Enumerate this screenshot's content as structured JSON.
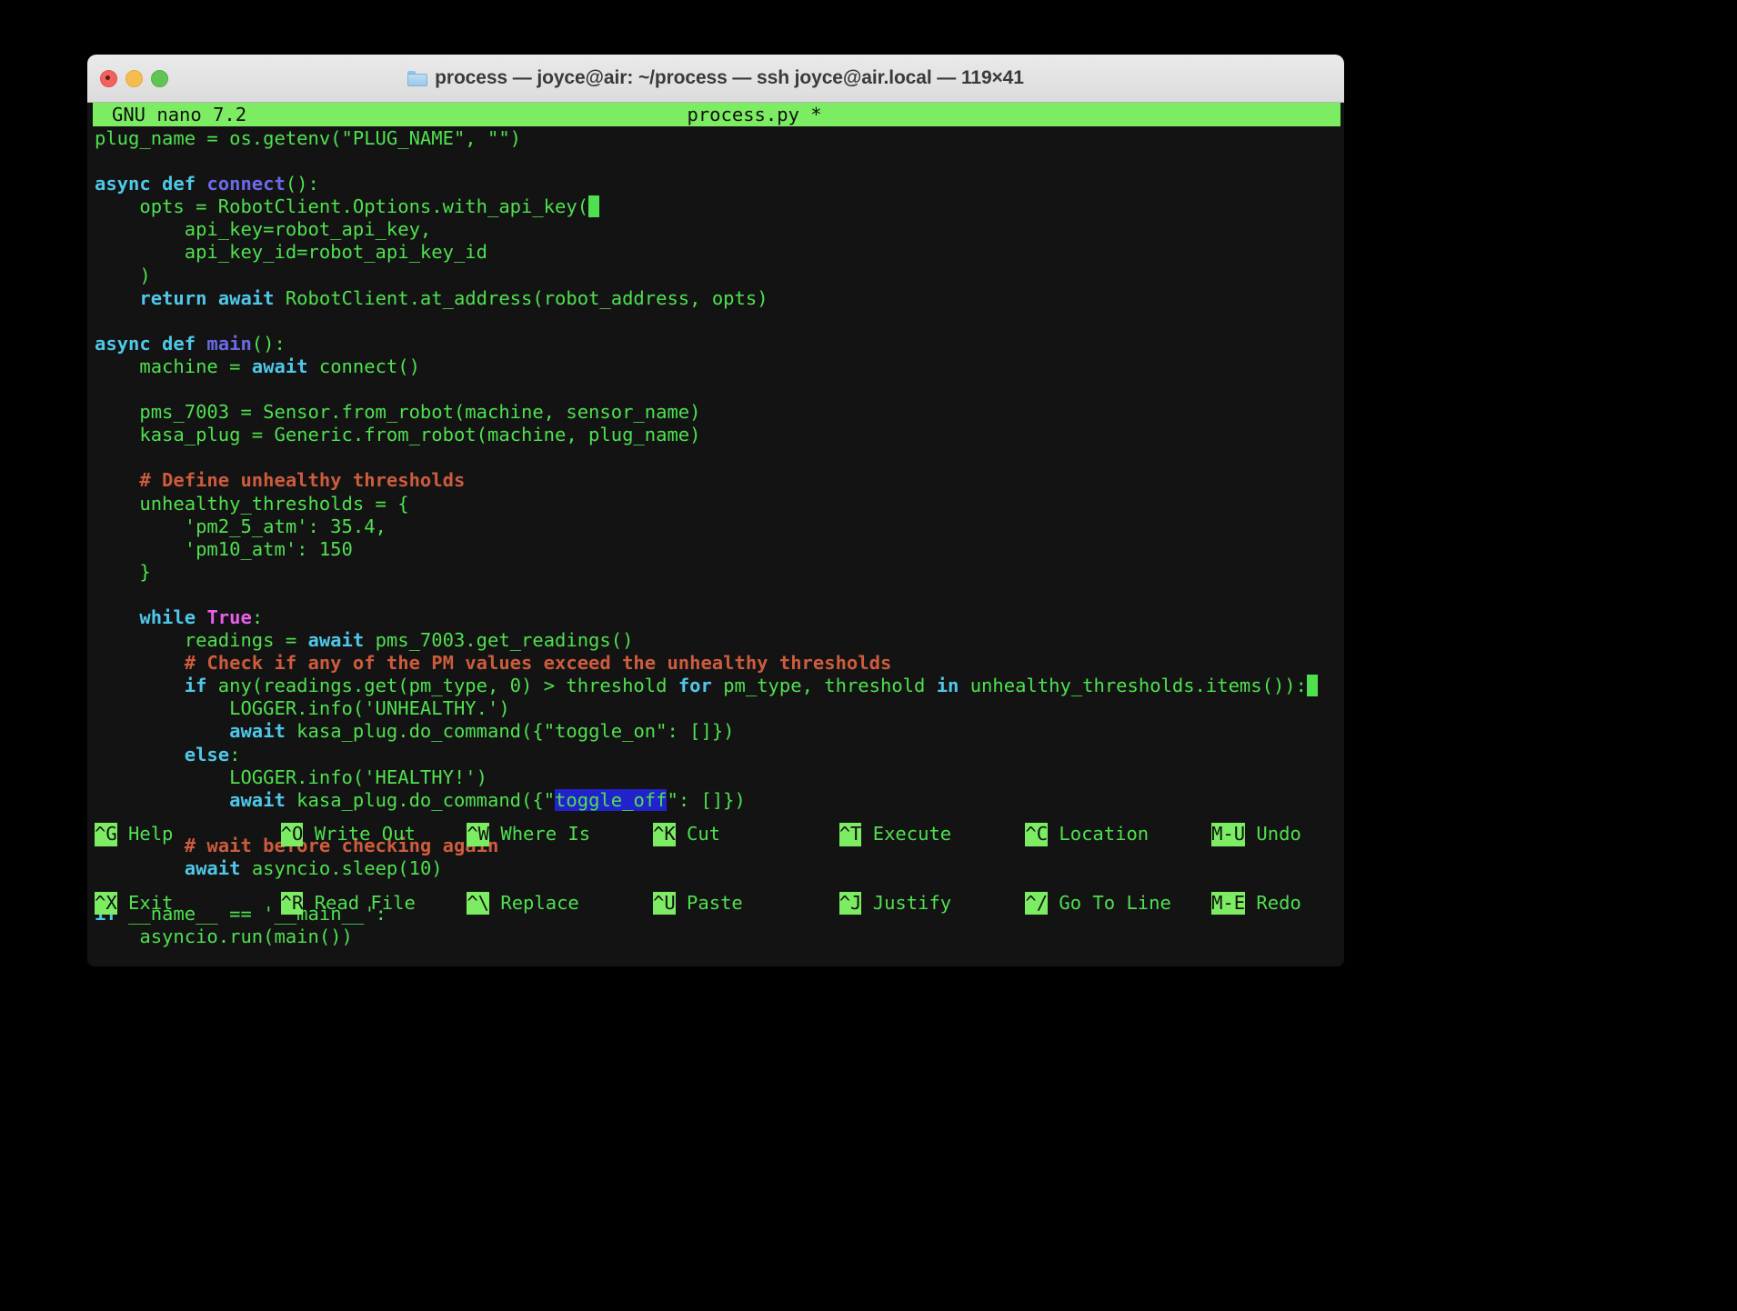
{
  "window": {
    "title": "process — joyce@air: ~/process — ssh joyce@air.local — 119×41",
    "folder_icon": "folder-icon",
    "traffic_lights": [
      "close",
      "minimize",
      "maximize"
    ]
  },
  "nano": {
    "version": "GNU nano 7.2",
    "filename": "process.py *",
    "header_bg": "#7ced62",
    "header_fg": "#101010"
  },
  "colors": {
    "terminal_bg": "#131313",
    "default_text": "#4fe04f",
    "keyword": "#4fc7e8",
    "builtin": "#e85fe8",
    "function": "#6a6ae8",
    "comment": "#cc5c3d",
    "selection_bg": "#2222cc",
    "cursor": "#4fe04f"
  },
  "code_lines": [
    [
      {
        "t": "plug_name = os.getenv(\"PLUG_NAME\", \"\")",
        "c": "plain"
      }
    ],
    [],
    [
      {
        "t": "async def ",
        "c": "kw"
      },
      {
        "t": "connect",
        "c": "fn"
      },
      {
        "t": "():",
        "c": "plain"
      }
    ],
    [
      {
        "t": "    opts = RobotClient.Options.with_api_key(",
        "c": "plain"
      },
      {
        "t": " ",
        "c": "cursor"
      }
    ],
    [
      {
        "t": "        api_key=robot_api_key,",
        "c": "plain"
      }
    ],
    [
      {
        "t": "        api_key_id=robot_api_key_id",
        "c": "plain"
      }
    ],
    [
      {
        "t": "    )",
        "c": "plain"
      }
    ],
    [
      {
        "t": "    ",
        "c": "plain"
      },
      {
        "t": "return await ",
        "c": "kw"
      },
      {
        "t": "RobotClient.at_address(robot_address, opts)",
        "c": "plain"
      }
    ],
    [],
    [
      {
        "t": "async def ",
        "c": "kw"
      },
      {
        "t": "main",
        "c": "fn"
      },
      {
        "t": "():",
        "c": "plain"
      }
    ],
    [
      {
        "t": "    machine = ",
        "c": "plain"
      },
      {
        "t": "await ",
        "c": "kw"
      },
      {
        "t": "connect()",
        "c": "plain"
      }
    ],
    [],
    [
      {
        "t": "    pms_7003 = Sensor.from_robot(machine, sensor_name)",
        "c": "plain"
      }
    ],
    [
      {
        "t": "    kasa_plug = Generic.from_robot(machine, plug_name)",
        "c": "plain"
      }
    ],
    [],
    [
      {
        "t": "    # Define unhealthy thresholds",
        "c": "com"
      }
    ],
    [
      {
        "t": "    unhealthy_thresholds = {",
        "c": "plain"
      }
    ],
    [
      {
        "t": "        'pm2_5_atm': 35.4,",
        "c": "str"
      }
    ],
    [
      {
        "t": "        'pm10_atm': 150",
        "c": "str"
      }
    ],
    [
      {
        "t": "    }",
        "c": "plain"
      }
    ],
    [],
    [
      {
        "t": "    ",
        "c": "plain"
      },
      {
        "t": "while ",
        "c": "kw"
      },
      {
        "t": "True",
        "c": "kw2"
      },
      {
        "t": ":",
        "c": "plain"
      }
    ],
    [
      {
        "t": "        readings = ",
        "c": "plain"
      },
      {
        "t": "await ",
        "c": "kw"
      },
      {
        "t": "pms_7003.get_readings()",
        "c": "plain"
      }
    ],
    [
      {
        "t": "        # Check if any of the PM values exceed the unhealthy thresholds",
        "c": "com"
      }
    ],
    [
      {
        "t": "        ",
        "c": "plain"
      },
      {
        "t": "if ",
        "c": "kw"
      },
      {
        "t": "any(readings.get(pm_type, 0) > threshold ",
        "c": "plain"
      },
      {
        "t": "for ",
        "c": "kw"
      },
      {
        "t": "pm_type, threshold ",
        "c": "plain"
      },
      {
        "t": "in ",
        "c": "kw"
      },
      {
        "t": "unhealthy_thresholds.items()):",
        "c": "plain"
      },
      {
        "t": " ",
        "c": "cursor"
      }
    ],
    [
      {
        "t": "            LOGGER.info(",
        "c": "plain"
      },
      {
        "t": "'UNHEALTHY.'",
        "c": "str"
      },
      {
        "t": ")",
        "c": "plain"
      }
    ],
    [
      {
        "t": "            ",
        "c": "plain"
      },
      {
        "t": "await ",
        "c": "kw"
      },
      {
        "t": "kasa_plug.do_command({",
        "c": "plain"
      },
      {
        "t": "\"toggle_on\"",
        "c": "str"
      },
      {
        "t": ": []})",
        "c": "plain"
      }
    ],
    [
      {
        "t": "        ",
        "c": "plain"
      },
      {
        "t": "else",
        "c": "kw"
      },
      {
        "t": ":",
        "c": "plain"
      }
    ],
    [
      {
        "t": "            LOGGER.info(",
        "c": "plain"
      },
      {
        "t": "'HEALTHY!'",
        "c": "str"
      },
      {
        "t": ")",
        "c": "plain"
      }
    ],
    [
      {
        "t": "            ",
        "c": "plain"
      },
      {
        "t": "await ",
        "c": "kw"
      },
      {
        "t": "kasa_plug.do_command({",
        "c": "plain"
      },
      {
        "t": "\"",
        "c": "str"
      },
      {
        "t": "toggle_off",
        "c": "sel"
      },
      {
        "t": "\"",
        "c": "str"
      },
      {
        "t": ": []})",
        "c": "plain"
      }
    ],
    [],
    [
      {
        "t": "        # wait before checking again",
        "c": "com"
      }
    ],
    [
      {
        "t": "        ",
        "c": "plain"
      },
      {
        "t": "await ",
        "c": "kw"
      },
      {
        "t": "asyncio.sleep(10)",
        "c": "plain"
      }
    ],
    [],
    [
      {
        "t": "if ",
        "c": "kw"
      },
      {
        "t": "__name__ == ",
        "c": "plain"
      },
      {
        "t": "'__main__'",
        "c": "str"
      },
      {
        "t": ":",
        "c": "plain"
      }
    ],
    [
      {
        "t": "    asyncio.run(main())",
        "c": "plain"
      }
    ]
  ],
  "shortcuts": {
    "row1": [
      {
        "key": "^G",
        "label": "Help"
      },
      {
        "key": "^O",
        "label": "Write Out"
      },
      {
        "key": "^W",
        "label": "Where Is"
      },
      {
        "key": "^K",
        "label": "Cut"
      },
      {
        "key": "^T",
        "label": "Execute"
      },
      {
        "key": "^C",
        "label": "Location"
      },
      {
        "key": "M-U",
        "label": "Undo"
      }
    ],
    "row2": [
      {
        "key": "^X",
        "label": "Exit"
      },
      {
        "key": "^R",
        "label": "Read File"
      },
      {
        "key": "^\\",
        "label": "Replace"
      },
      {
        "key": "^U",
        "label": "Paste"
      },
      {
        "key": "^J",
        "label": "Justify"
      },
      {
        "key": "^/",
        "label": "Go To Line"
      },
      {
        "key": "M-E",
        "label": "Redo"
      }
    ]
  }
}
